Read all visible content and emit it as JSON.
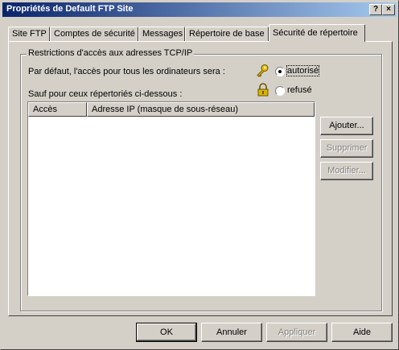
{
  "window": {
    "title": "Propriétés de Default FTP Site",
    "help_label": "?",
    "close_label": "×"
  },
  "tabs": [
    {
      "label": "Site FTP"
    },
    {
      "label": "Comptes de sécurité"
    },
    {
      "label": "Messages"
    },
    {
      "label": "Répertoire de base"
    },
    {
      "label": "Sécurité de répertoire"
    }
  ],
  "group": {
    "title": "Restrictions d'accès aux adresses TCP/IP",
    "default_text": "Par défaut, l'accès pour tous les ordinateurs sera :",
    "options": [
      {
        "label": "autorisé",
        "icon": "key-icon",
        "checked": true
      },
      {
        "label": "refusé",
        "icon": "lock-icon",
        "checked": false
      }
    ],
    "except_text": "Sauf pour  ceux répertoriés ci-dessous :",
    "columns": [
      "Accès",
      "Adresse IP (masque de sous-réseau)"
    ],
    "rows": [],
    "buttons": {
      "add": "Ajouter...",
      "remove": "Supprimer",
      "edit": "Modifier..."
    }
  },
  "footer": {
    "ok": "OK",
    "cancel": "Annuler",
    "apply": "Appliquer",
    "help": "Aide"
  },
  "colors": {
    "title_start": "#0a246a",
    "title_end": "#a6caf0",
    "face": "#d4d0c8",
    "key": "#e8c000",
    "lock": "#d8b400"
  }
}
